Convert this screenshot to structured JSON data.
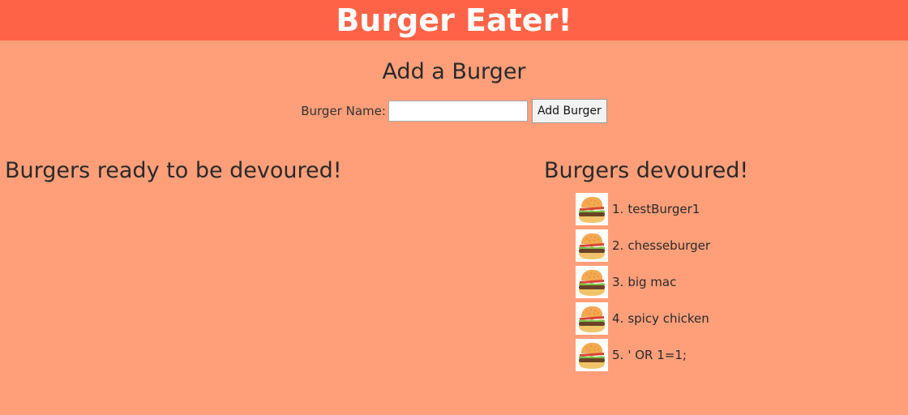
{
  "header": {
    "title": "Burger Eater!"
  },
  "add_form": {
    "heading": "Add a Burger",
    "label": "Burger Name:",
    "input_value": "",
    "button_label": "Add Burger"
  },
  "ready": {
    "heading": "Burgers ready to be devoured!",
    "items": []
  },
  "devoured": {
    "heading": "Burgers devoured!",
    "items": [
      {
        "number": "1.",
        "name": "testBurger1",
        "icon": "burger-icon"
      },
      {
        "number": "2.",
        "name": "chesseburger",
        "icon": "burger-icon"
      },
      {
        "number": "3.",
        "name": "big mac",
        "icon": "burger-icon"
      },
      {
        "number": "4.",
        "name": "spicy chicken",
        "icon": "burger-icon"
      },
      {
        "number": "5.",
        "name": "' OR 1=1;",
        "icon": "burger-icon"
      }
    ]
  },
  "colors": {
    "header_bg": "#FF6347",
    "page_bg": "#FF9F7A",
    "header_text": "#FFFFFF"
  }
}
